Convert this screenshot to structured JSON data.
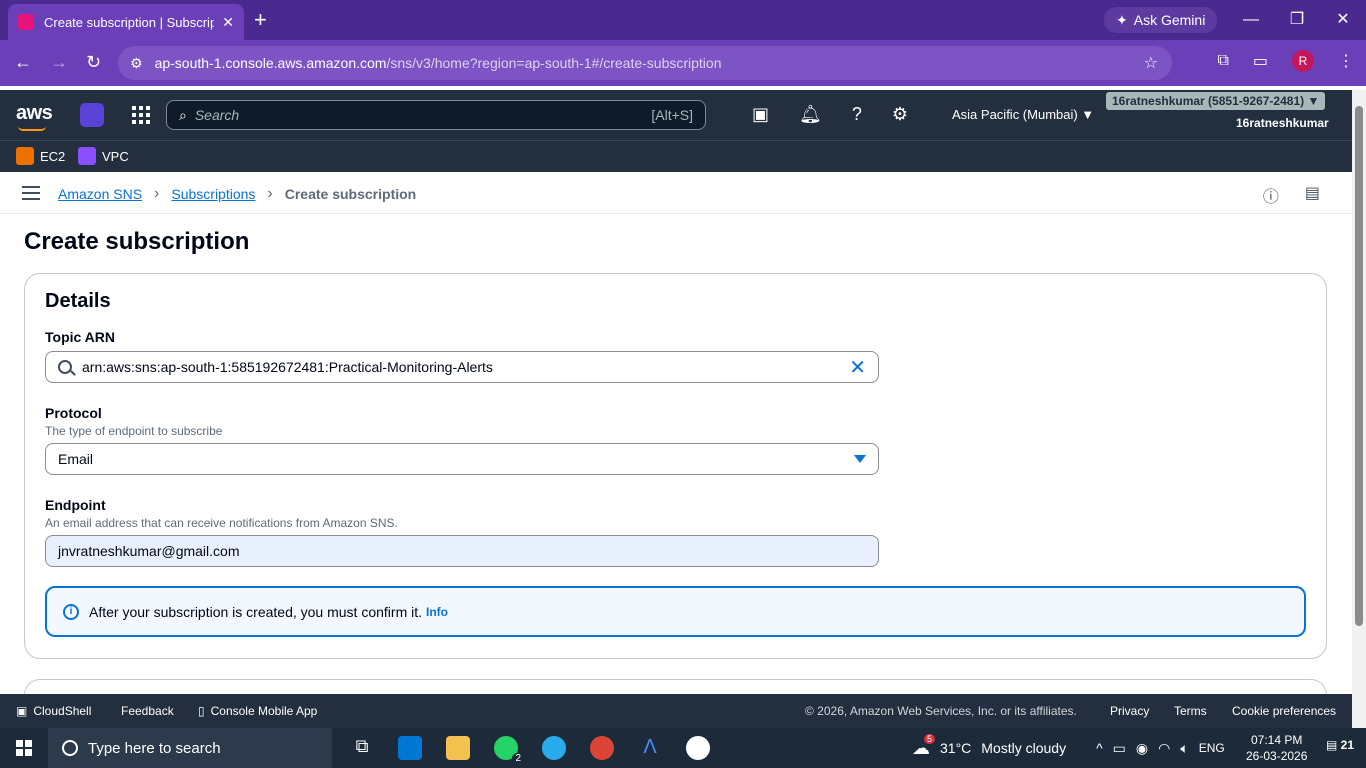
{
  "browser": {
    "tab_title": "Create subscription | Subscriptio",
    "new_tab": "+",
    "ask_gemini": "Ask Gemini",
    "url_host": "ap-south-1.console.aws.amazon.com",
    "url_path": "/sns/v3/home?region=ap-south-1#/create-subscription",
    "profile_initial": "R"
  },
  "aws_nav": {
    "logo": "aws",
    "search_placeholder": "Search",
    "search_shortcut": "[Alt+S]",
    "region": "Asia Pacific (Mumbai) ▼",
    "account": "16ratneshkumar (5851-9267-2481) ▼",
    "user": "16ratneshkumar"
  },
  "favorites": [
    {
      "label": "EC2",
      "color": "#ed7100"
    },
    {
      "label": "VPC",
      "color": "#8c4fff"
    }
  ],
  "breadcrumb": {
    "items": [
      "Amazon SNS",
      "Subscriptions"
    ],
    "current": "Create subscription"
  },
  "page": {
    "title": "Create subscription",
    "details_title": "Details",
    "topic_arn_label": "Topic ARN",
    "topic_arn_value": "arn:aws:sns:ap-south-1:585192672481:Practical-Monitoring-Alerts",
    "protocol_label": "Protocol",
    "protocol_desc": "The type of endpoint to subscribe",
    "protocol_value": "Email",
    "endpoint_label": "Endpoint",
    "endpoint_desc": "An email address that can receive notifications from Amazon SNS.",
    "endpoint_value": "jnvratneshkumar@gmail.com",
    "alert_text": "After your subscription is created, you must confirm it.",
    "alert_info": "Info"
  },
  "footer": {
    "cloudshell": "CloudShell",
    "feedback": "Feedback",
    "mobile_app": "Console Mobile App",
    "copyright": "© 2026, Amazon Web Services, Inc. or its affiliates.",
    "privacy": "Privacy",
    "terms": "Terms",
    "cookies": "Cookie preferences"
  },
  "taskbar": {
    "search_placeholder": "Type here to search",
    "weather_badge": "5",
    "temperature": "31°C",
    "weather": "Mostly cloudy",
    "lang": "ENG",
    "time": "07:14 PM",
    "date": "26-03-2026",
    "notifications": "21",
    "whatsapp_badge": "2"
  },
  "colors": {
    "aws_nav": "#232f3e",
    "link_blue": "#0972d3",
    "chrome_purple": "#6a3fb8"
  }
}
